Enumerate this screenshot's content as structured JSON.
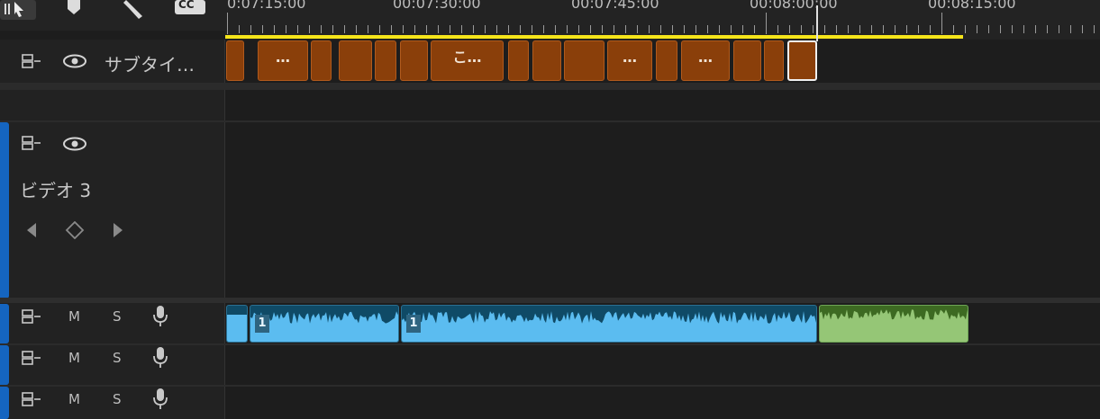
{
  "ruler": {
    "timecodes": [
      "0:07:15:00",
      "00:07:30:00",
      "00:07:45:00",
      "00:08:00:00",
      "00:08:15:00"
    ],
    "playhead_color": "#ffffff",
    "work_area_color": "#f5e51a"
  },
  "toolbar": {
    "icons": [
      "track-select-icon",
      "marker-icon",
      "wrench-icon",
      "captions-icon"
    ],
    "captions_label": "CC"
  },
  "subtitle_track": {
    "label": "サブタイ…",
    "clip_texts": [
      "…",
      "こ…",
      "…",
      "…"
    ],
    "clip_color": "#8a3f0a"
  },
  "video_track": {
    "label": "ビデオ 3",
    "accent_color": "#1565c0"
  },
  "audio_tracks": [
    {
      "m": "M",
      "s": "S",
      "clip_badge_a": "1",
      "clip_badge_b": "1"
    },
    {
      "m": "M",
      "s": "S"
    },
    {
      "m": "M",
      "s": "S"
    }
  ],
  "colors": {
    "audio_blue": "#5bbcf0",
    "audio_green": "#95c676",
    "track_accent": "#1565c0"
  }
}
